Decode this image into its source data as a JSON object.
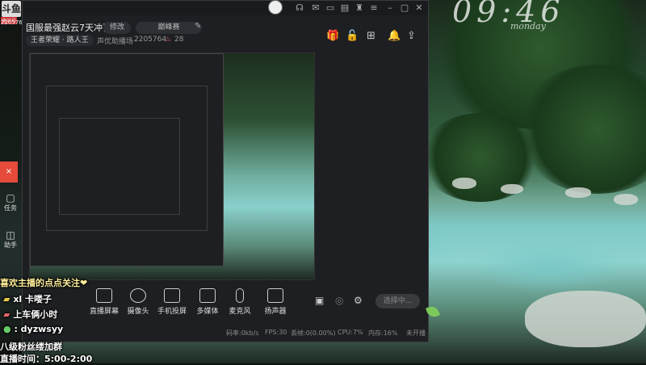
{
  "background": {
    "title": "09:46",
    "subtitle": "monday"
  },
  "leftbar": {
    "logo": "斗鱼",
    "logo_sub": "房间号",
    "room_id": "2205764",
    "items": [
      {
        "label": "×"
      },
      {
        "label": "任务"
      },
      {
        "label": "助手"
      }
    ]
  },
  "window": {
    "room_title": "国服最强赵云7天冲百星",
    "edit_label": "修改",
    "category_label": "巅峰赛",
    "rank_label": "王者荣耀 · 路人王",
    "fans_label": "声优助播场",
    "room_number": "2205764",
    "fire_count": "28",
    "tools": [
      {
        "label": "直播屏幕"
      },
      {
        "label": "摄像头"
      },
      {
        "label": "手机投屏"
      },
      {
        "label": "多媒体"
      },
      {
        "label": "麦克风"
      },
      {
        "label": "扬声器"
      }
    ],
    "live_button": "选择中...",
    "status": {
      "upload": "码率:0kb/s",
      "fps": "FPS:30",
      "drop": "丢帧:0(0.00%)",
      "cpu": "CPU:7%",
      "memory": "内存:16%",
      "state": "未开播"
    }
  },
  "overlay": {
    "follow": "喜欢主播的点点关注❤",
    "line1": "xl 卡喽子",
    "line2": "上车俩小时",
    "line3": ": dyzwsyy",
    "line4": "八级粉丝缕加群",
    "line5": "直播时间：5:00-2:00"
  }
}
